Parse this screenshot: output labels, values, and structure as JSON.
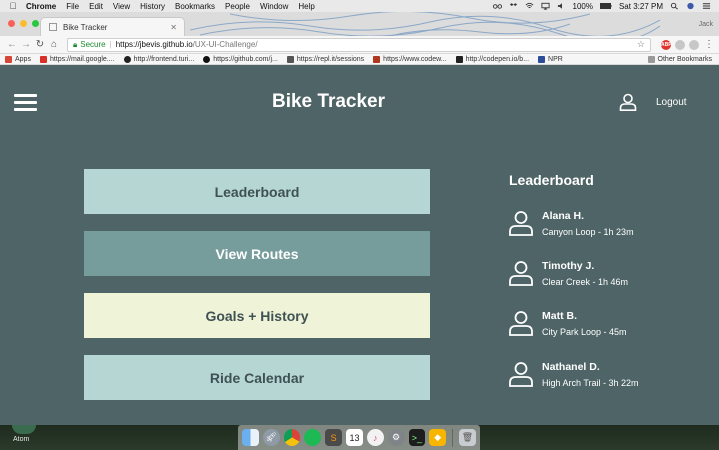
{
  "menubar": {
    "app_name": "Chrome",
    "items": [
      "File",
      "Edit",
      "View",
      "History",
      "Bookmarks",
      "People",
      "Window",
      "Help"
    ],
    "battery": "100%",
    "clock": "Sat 3:27 PM"
  },
  "browser": {
    "tab_title": "Bike Tracker",
    "profile_name": "Jack",
    "url_secure_label": "Secure",
    "url_scheme_host": "https://jbevis.github.io",
    "url_path": "/UX-UI-Challenge/",
    "bookmarks": [
      {
        "label": "Apps",
        "color": "#d8463a"
      },
      {
        "label": "https://mail.google....",
        "color": "#d93025"
      },
      {
        "label": "http://frontend.turi...",
        "color": "#222222"
      },
      {
        "label": "https://github.com/j...",
        "color": "#111111"
      },
      {
        "label": "https://repl.it/sessions",
        "color": "#555555"
      },
      {
        "label": "https://www.codew...",
        "color": "#b1361e"
      },
      {
        "label": "http://codepen.io/b...",
        "color": "#222222"
      },
      {
        "label": "NPR",
        "color": "#2d4d9a"
      }
    ],
    "other_bookmarks": "Other Bookmarks"
  },
  "app": {
    "title": "Bike Tracker",
    "logout_label": "Logout",
    "nav": {
      "leaderboard": "Leaderboard",
      "view_routes": "View Routes",
      "goals_history": "Goals + History",
      "ride_calendar": "Ride Calendar"
    },
    "leaderboard": {
      "title": "Leaderboard",
      "entries": [
        {
          "name": "Alana H.",
          "route": "Canyon Loop - 1h 23m"
        },
        {
          "name": "Timothy J.",
          "route": "Clear Creek - 1h 46m"
        },
        {
          "name": "Matt B.",
          "route": "City Park Loop - 45m"
        },
        {
          "name": "Nathanel D.",
          "route": "High Arch Trail - 3h 22m"
        }
      ]
    }
  },
  "desktop": {
    "atom_label": "Atom",
    "calendar_day": "13"
  },
  "colors": {
    "app_background": "#4f6466",
    "button_light": "#b6d6d4",
    "button_dark": "#779c9c",
    "button_cream": "#eff4d9"
  }
}
